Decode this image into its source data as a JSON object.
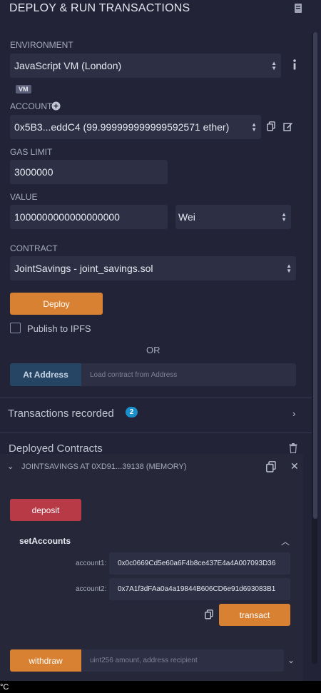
{
  "header": {
    "title": "DEPLOY & RUN TRANSACTIONS"
  },
  "environment": {
    "label": "ENVIRONMENT",
    "value": "JavaScript VM (London)",
    "badge": "VM"
  },
  "account": {
    "label": "ACCOUNT",
    "value": "0x5B3...eddC4 (99.999999999999592571 ether)"
  },
  "gas_limit": {
    "label": "GAS LIMIT",
    "value": "3000000"
  },
  "value": {
    "label": "VALUE",
    "amount": "1000000000000000000",
    "unit": "Wei"
  },
  "contract": {
    "label": "CONTRACT",
    "value": "JointSavings - joint_savings.sol"
  },
  "deploy": {
    "button": "Deploy",
    "publish_label": "Publish to IPFS",
    "or_text": "OR"
  },
  "at_address": {
    "button": "At Address",
    "placeholder": "Load contract from Address"
  },
  "transactions": {
    "label": "Transactions recorded",
    "count": "2"
  },
  "deployed": {
    "label": "Deployed Contracts",
    "instance_title": "JOINTSAVINGS AT 0XD91...39138 (MEMORY)",
    "deposit_button": "deposit",
    "set_accounts": {
      "title": "setAccounts",
      "account1_label": "account1:",
      "account1_value": "0x0c0669Cd5e60a6F4b8ce437E4a4A007093D36",
      "account2_label": "account2:",
      "account2_value": "0x7A1f3dFAa0a4a19844B606CD6e91d693083B1",
      "transact_button": "transact"
    },
    "withdraw": {
      "button": "withdraw",
      "placeholder": "uint256 amount, address recipient"
    }
  },
  "footer": {
    "temp_unit": "°C"
  },
  "colors": {
    "accent_orange": "#d88133",
    "accent_red": "#b73a46",
    "badge_blue": "#1a8fc9",
    "bg": "#222336",
    "field": "#2d2f45"
  }
}
